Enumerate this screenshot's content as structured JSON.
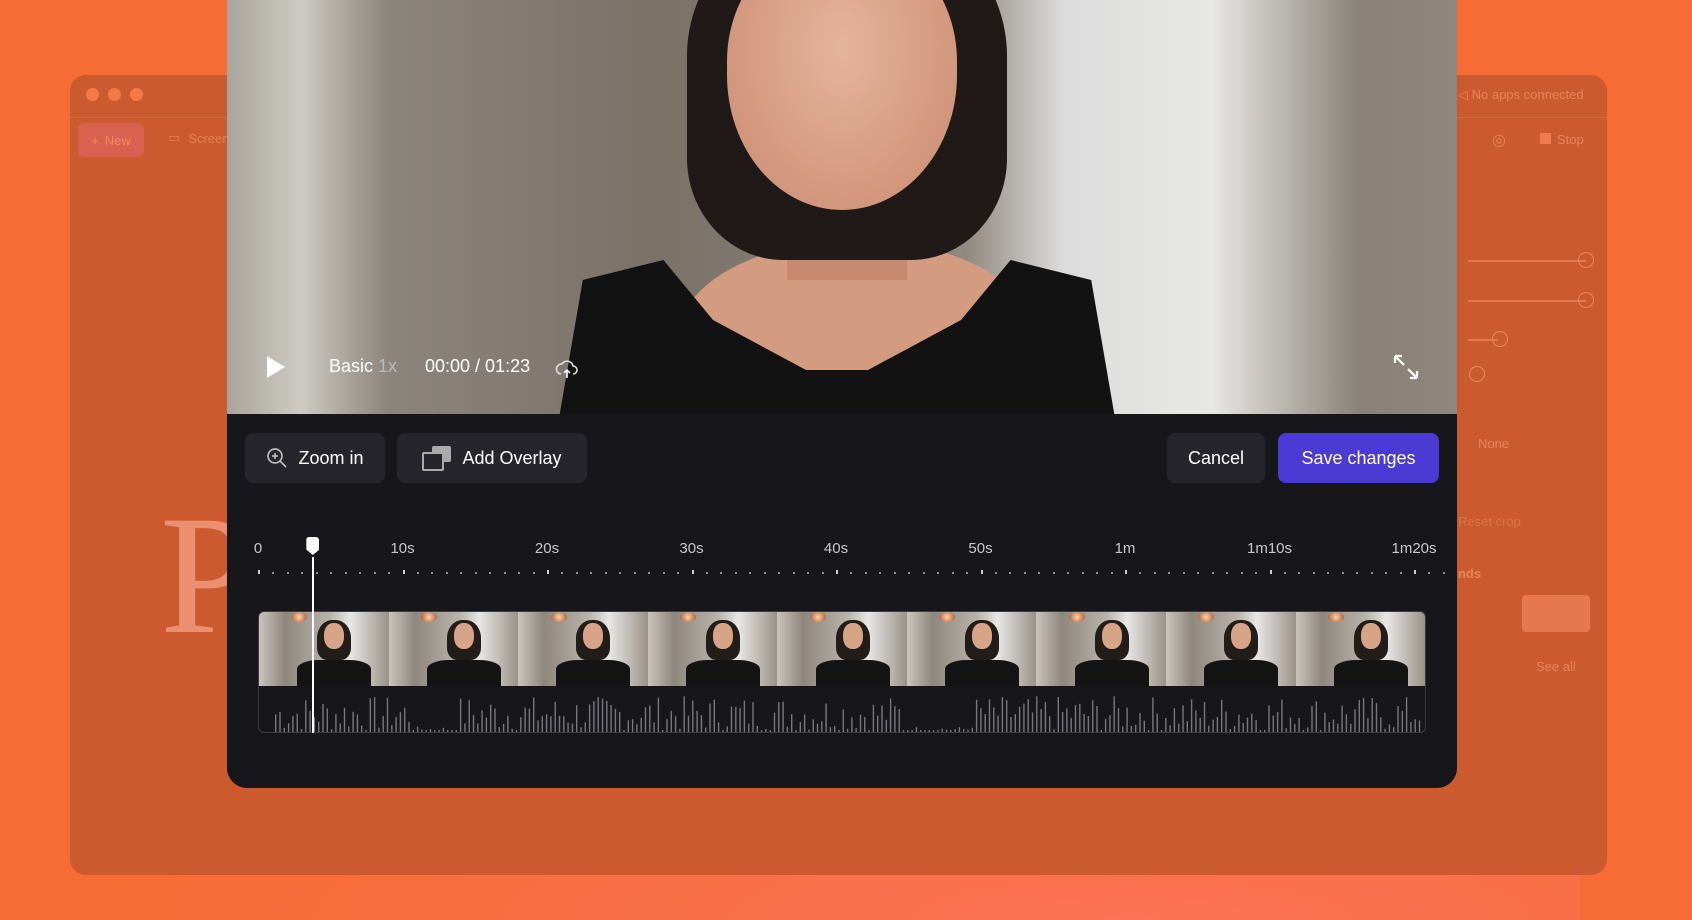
{
  "background_app": {
    "new_label": "New",
    "screen_label": "Screen",
    "apps_status": "No apps connected",
    "stop_label": "Stop",
    "select_value": "None",
    "reset_crop": "Reset crop",
    "backgrounds_heading": "Backgrounds",
    "see_all": "See all"
  },
  "player": {
    "mode": "Basic",
    "speed": "1x",
    "time": "00:00 / 01:23",
    "progress_seconds": 0,
    "duration_seconds": 83
  },
  "toolbar": {
    "zoom_in": "Zoom in",
    "add_overlay": "Add Overlay",
    "cancel": "Cancel",
    "save": "Save changes"
  },
  "timeline": {
    "labels": [
      "0",
      "10s",
      "20s",
      "30s",
      "40s",
      "50s",
      "1m",
      "1m10s",
      "1m20s"
    ],
    "playhead_seconds": 3
  },
  "colors": {
    "accent": "#4B3AD4",
    "background": "#F76B35",
    "panel": "#16161B"
  },
  "icons": [
    "play-icon",
    "cloud-upload-icon",
    "expand-icon",
    "zoom-in-icon",
    "overlay-icon"
  ]
}
